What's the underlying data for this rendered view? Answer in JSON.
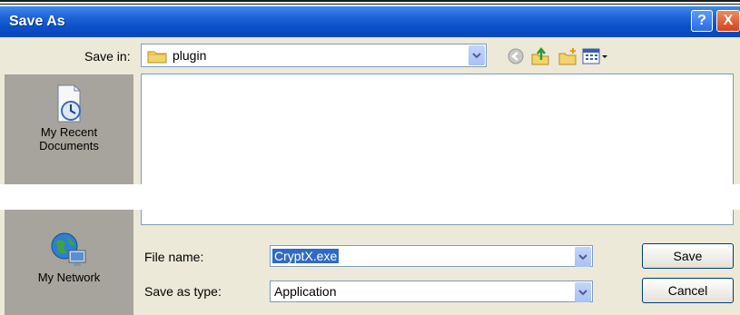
{
  "window": {
    "title": "Save As",
    "help_label": "?",
    "close_label": "X"
  },
  "toolbar": {
    "save_in_label": "Save in:",
    "save_in_value": "plugin",
    "icons": [
      "back-icon",
      "up-folder-icon",
      "new-folder-icon",
      "view-menu-icon"
    ]
  },
  "places": {
    "recent_label": "My Recent Documents",
    "recent_line1": "My Recent",
    "recent_line2": "Documents",
    "network_label": "My Network"
  },
  "form": {
    "filename_label": "File name:",
    "filename_value": "CryptX.exe",
    "savetype_label": "Save as type:",
    "savetype_value": "Application"
  },
  "buttons": {
    "save_label": "Save",
    "cancel_label": "Cancel"
  },
  "colors": {
    "titlebar": "#0b4fc8",
    "dialog_bg": "#ece9d8",
    "selection": "#316ac5"
  }
}
